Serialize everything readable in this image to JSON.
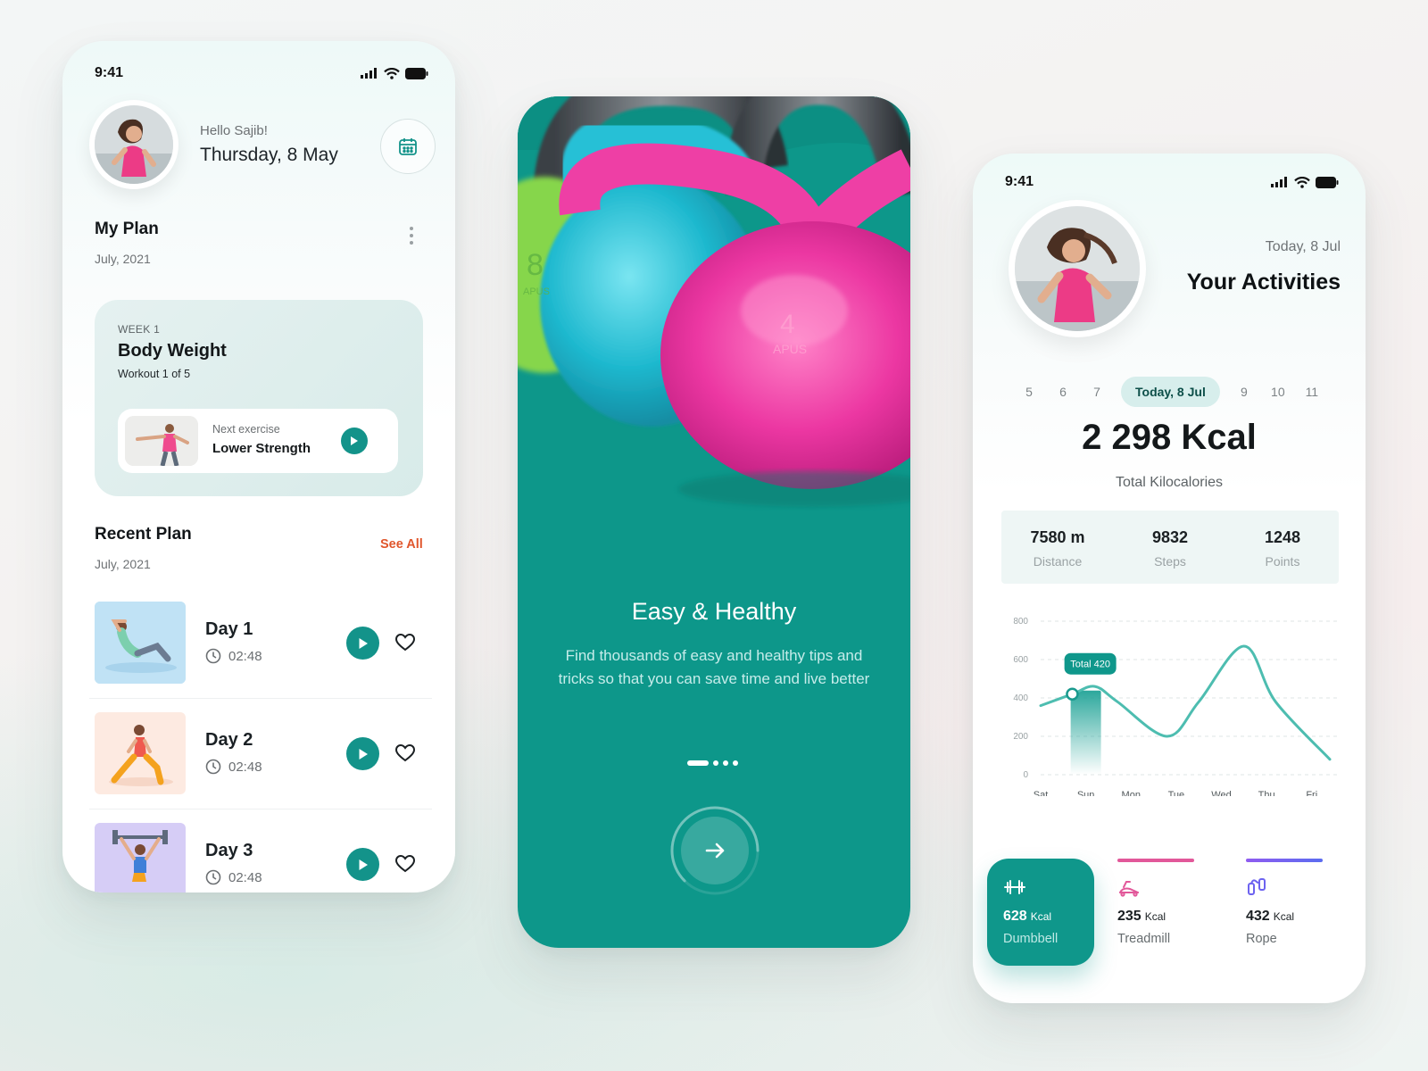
{
  "status": {
    "time": "9:41"
  },
  "home": {
    "greeting": "Hello Sajib!",
    "date": "Thursday, 8 May",
    "my_plan": {
      "title": "My Plan",
      "subtitle": "July, 2021"
    },
    "plan_card": {
      "week": "WEEK 1",
      "title": "Body Weight",
      "subtitle": "Workout 1 of 5",
      "next_label": "Next exercise",
      "next_name": "Lower Strength"
    },
    "recent_plan": {
      "title": "Recent Plan",
      "subtitle": "July, 2021",
      "see_all": "See All"
    },
    "days": [
      {
        "name": "Day 1",
        "time": "02:48"
      },
      {
        "name": "Day 2",
        "time": "02:48"
      },
      {
        "name": "Day 3",
        "time": "02:48"
      }
    ]
  },
  "onboarding": {
    "title": "Easy & Healthy",
    "description": "Find thousands of easy and healthy tips and tricks so that you can save time and live better",
    "kettlebell_number": "4",
    "kettlebell_brand": "APUS",
    "kettlebell_number_2": "8",
    "kettlebell_brand_2": "APUS",
    "page_index": 1,
    "page_count": 4
  },
  "activities": {
    "date_sub": "Today, 8 Jul",
    "title": "Your Activities",
    "days": [
      "5",
      "6",
      "7",
      "Today, 8 Jul",
      "9",
      "10",
      "11"
    ],
    "selected_day": 3,
    "total_kcal": "2 298 Kcal",
    "total_label": "Total Kilocalories",
    "stats": [
      {
        "value": "7580 m",
        "label": "Distance"
      },
      {
        "value": "9832",
        "label": "Steps"
      },
      {
        "value": "1248",
        "label": "Points"
      }
    ],
    "cards": [
      {
        "value": "628",
        "unit": "Kcal",
        "name": "Dumbbell",
        "icon": "dumbbell-icon",
        "color": "#0f978b"
      },
      {
        "value": "235",
        "unit": "Kcal",
        "name": "Treadmill",
        "icon": "treadmill-icon",
        "color": "#e2589a"
      },
      {
        "value": "432",
        "unit": "Kcal",
        "name": "Rope",
        "icon": "rope-icon",
        "color": "#8f5cf0"
      }
    ]
  },
  "chart_data": {
    "type": "line",
    "categories": [
      "Sat",
      "Sun",
      "Mon",
      "Tue",
      "Wed",
      "Thu",
      "Fri"
    ],
    "values": [
      360,
      420,
      460,
      380,
      200,
      380,
      670,
      380,
      80
    ],
    "x": [
      0,
      0.7,
      1.2,
      1.7,
      2.8,
      3.5,
      4.5,
      5.2,
      6.4
    ],
    "ylim": [
      0,
      800
    ],
    "yticks": [
      0,
      200,
      400,
      600,
      800
    ],
    "highlight": {
      "category": "Sun",
      "label": "Total 420",
      "value": 420
    },
    "grid": true,
    "line_color": "#4dbdb0"
  }
}
